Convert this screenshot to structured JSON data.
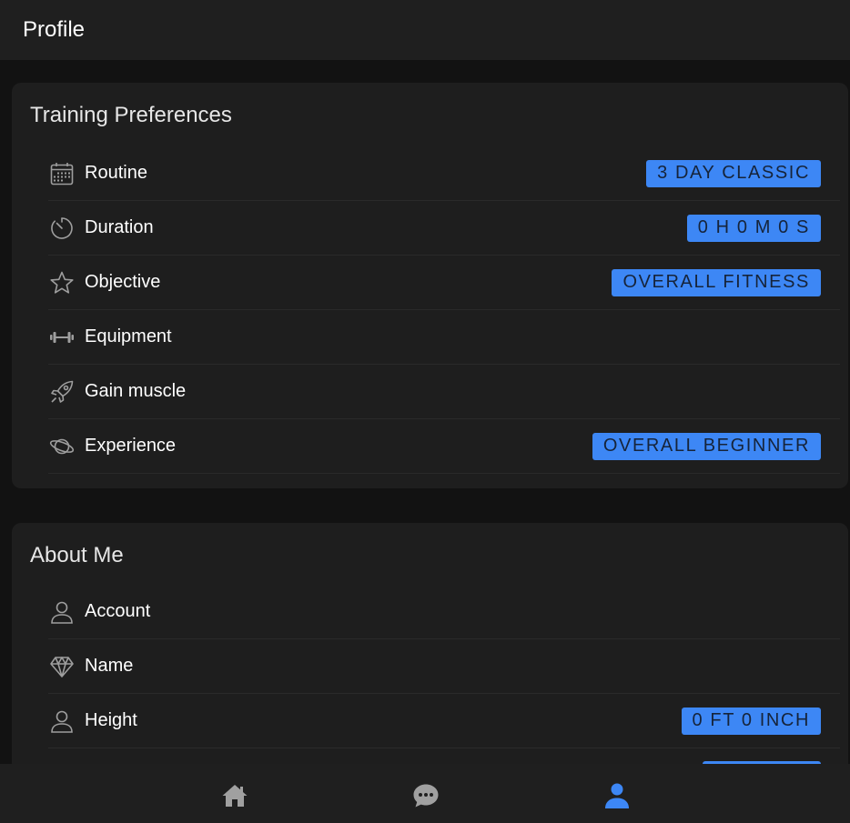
{
  "header": {
    "title": "Profile"
  },
  "training": {
    "title": "Training Preferences",
    "items": [
      {
        "label": "Routine",
        "value": "3 DAY CLASSIC",
        "icon": "calendar-icon"
      },
      {
        "label": "Duration",
        "value": "0 H 0 M 0 S",
        "icon": "timer-icon"
      },
      {
        "label": "Objective",
        "value": "OVERALL FITNESS",
        "icon": "star-icon"
      },
      {
        "label": "Equipment",
        "value": "",
        "icon": "dumbbell-icon"
      },
      {
        "label": "Gain muscle",
        "value": "",
        "icon": "rocket-icon"
      },
      {
        "label": "Experience",
        "value": "OVERALL BEGINNER",
        "icon": "planet-icon"
      }
    ]
  },
  "about": {
    "title": "About Me",
    "items": [
      {
        "label": "Account",
        "value": "",
        "icon": "user-icon"
      },
      {
        "label": "Name",
        "value": "",
        "icon": "diamond-icon"
      },
      {
        "label": "Height",
        "value": "0 FT 0 INCH",
        "icon": "user-icon"
      }
    ]
  },
  "nav": {
    "items": [
      {
        "name": "home",
        "icon": "home-icon"
      },
      {
        "name": "chat",
        "icon": "chat-icon"
      },
      {
        "name": "profile",
        "icon": "profile-icon",
        "active": true
      }
    ]
  },
  "colors": {
    "accent": "#3d87f5",
    "card": "#1e1e1e",
    "background": "#121212",
    "bar": "#1f1f1f"
  }
}
